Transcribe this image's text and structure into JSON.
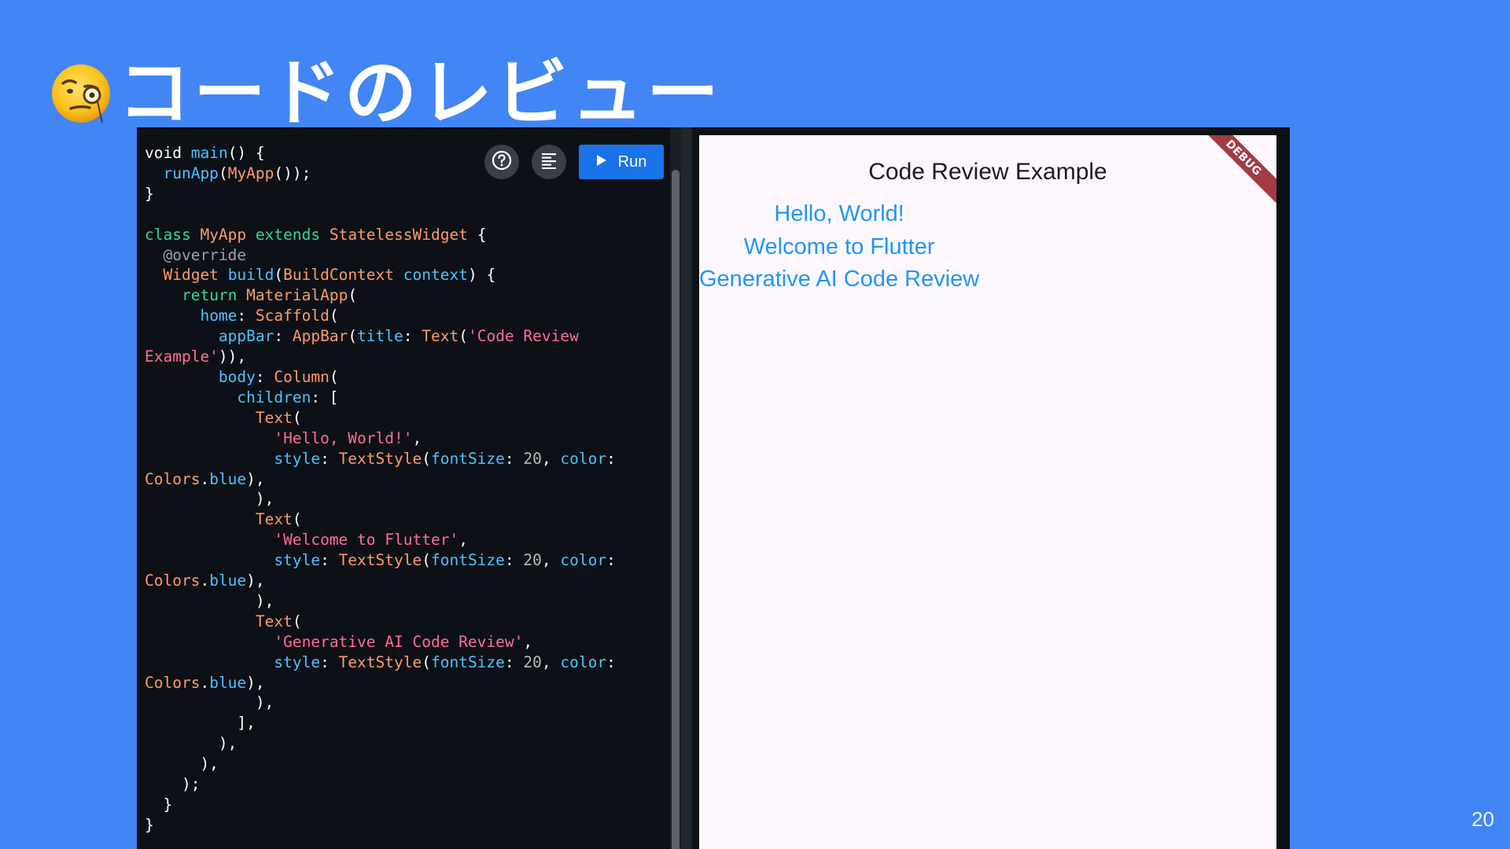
{
  "slide": {
    "title": "コードのレビュー",
    "title_icon": "monocle-face-emoji",
    "page_number": "20"
  },
  "editor": {
    "help_icon": "help-circle-icon",
    "format_icon": "format-align-icon",
    "run_label": "Run",
    "run_icon": "play-icon",
    "code_lines": [
      "void main() {",
      "  runApp(MyApp());",
      "}",
      "",
      "class MyApp extends StatelessWidget {",
      "  @override",
      "  Widget build(BuildContext context) {",
      "    return MaterialApp(",
      "      home: Scaffold(",
      "        appBar: AppBar(title: Text('Code Review",
      "Example')),",
      "        body: Column(",
      "          children: [",
      "            Text(",
      "              'Hello, World!',",
      "              style: TextStyle(fontSize: 20, color:",
      "Colors.blue),",
      "            ),",
      "            Text(",
      "              'Welcome to Flutter',",
      "              style: TextStyle(fontSize: 20, color:",
      "Colors.blue),",
      "            ),",
      "            Text(",
      "              'Generative AI Code Review',",
      "              style: TextStyle(fontSize: 20, color:",
      "Colors.blue),",
      "            ),",
      "          ],",
      "        ),",
      "      ),",
      "    );",
      "  }",
      "}"
    ]
  },
  "preview": {
    "appbar_title": "Code Review Example",
    "texts": [
      "Hello, World!",
      "Welcome to Flutter",
      "Generative AI Code Review"
    ],
    "text_color": "#2196f3",
    "debug_banner": "DEBUG"
  },
  "colors": {
    "slide_background": "#4285f4",
    "run_button": "#1a73e8",
    "editor_background": "#0d1117",
    "preview_background": "#fdf7fd",
    "debug_banner": "#a33b45"
  }
}
